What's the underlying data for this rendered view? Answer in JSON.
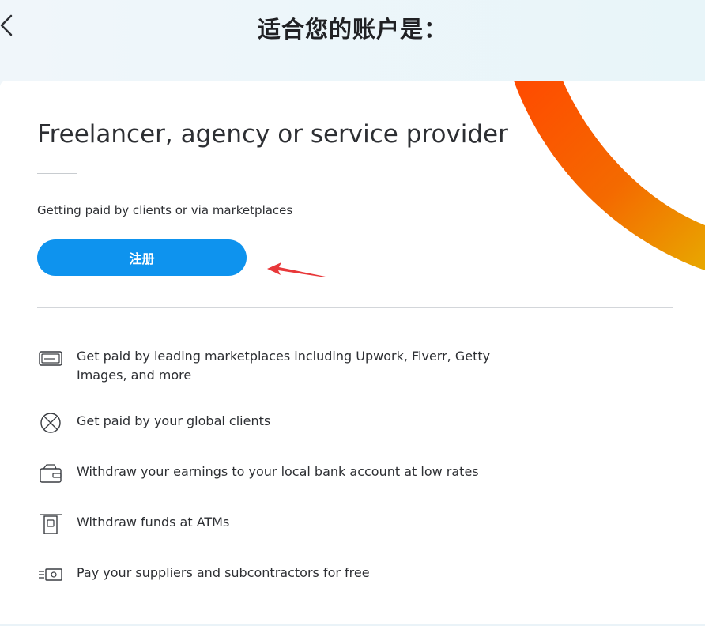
{
  "header": {
    "title": "适合您的账户是："
  },
  "card": {
    "title": "Freelancer, agency or service provider",
    "subtitle": "Getting paid by clients or via marketplaces",
    "signup_label": "注册"
  },
  "features": [
    {
      "icon": "card-icon",
      "text": "Get paid by leading marketplaces including Upwork, Fiverr, Getty Images, and more"
    },
    {
      "icon": "globe-icon",
      "text": "Get paid by your global clients"
    },
    {
      "icon": "wallet-icon",
      "text": "Withdraw your earnings to your local bank account at low rates"
    },
    {
      "icon": "atm-icon",
      "text": "Withdraw funds at ATMs"
    },
    {
      "icon": "cash-transfer-icon",
      "text": "Pay your suppliers and subcontractors for free"
    }
  ],
  "colors": {
    "primary_button": "#0e93ee",
    "arc_start": "#ff4a00",
    "arc_end": "#e8a800",
    "annotation_arrow": "#e8383a"
  }
}
